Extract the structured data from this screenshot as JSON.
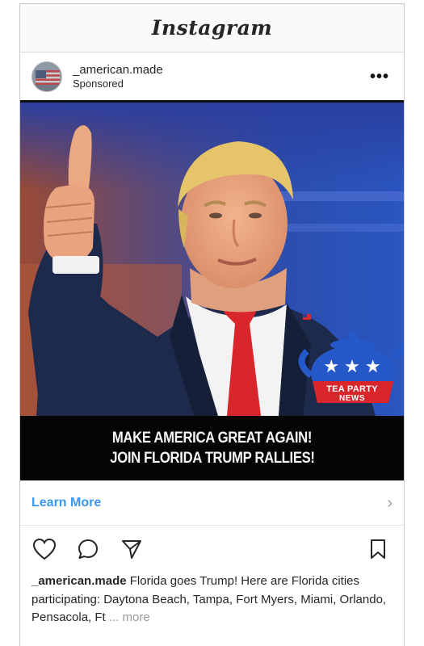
{
  "app": {
    "title": "Instagram"
  },
  "post": {
    "username": "_american.made",
    "sponsored_label": "Sponsored",
    "more_options": "•••",
    "image": {
      "badge_stars": "★★★",
      "badge_line1": "TEA PARTY",
      "badge_line2": "NEWS",
      "badge_color": "#2559c9",
      "badge_ribbon_color": "#d8262b"
    },
    "banner": {
      "line1": "MAKE AMERICA GREAT AGAIN!",
      "line2": "JOIN FLORIDA TRUMP RALLIES!"
    },
    "cta": {
      "label": "Learn More",
      "chevron": "›",
      "color": "#3897f0"
    },
    "actions": [
      "heart-icon",
      "comment-icon",
      "share-icon",
      "bookmark-icon"
    ],
    "caption": {
      "username": "_american.made",
      "text": " Florida goes Trump! Here are Florida cities participating: Daytona Beach, Tampa, Fort Myers, Miami, Orlando, Pensacola, Ft",
      "more": " ... more"
    }
  }
}
